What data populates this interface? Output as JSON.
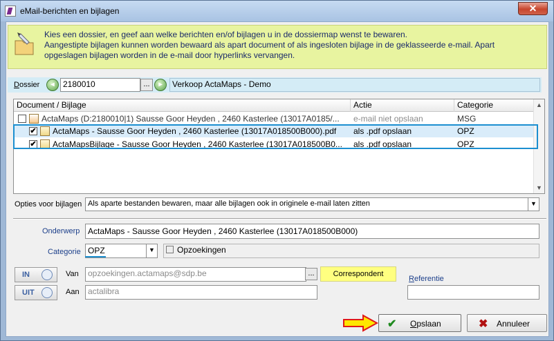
{
  "window": {
    "title": "eMail-berichten en bijlagen",
    "close": "✕"
  },
  "info": {
    "line1": "Kies een dossier, en geef aan welke berichten en/of bijlagen u in de dossiermap wenst te bewaren.",
    "line2": "Aangestipte bijlagen kunnen worden bewaard als apart document of als ingesloten bijlage in de geklasseerde e-mail. Apart",
    "line3": "opgeslagen bijlagen worden in de e-mail door hyperlinks vervangen."
  },
  "dossier": {
    "label": "Dossier",
    "number": "2180010",
    "dots": "...",
    "description": "Verkoop ActaMaps - Demo"
  },
  "list": {
    "columns": [
      "Document / Bijlage",
      "Actie",
      "Categorie"
    ],
    "rows": [
      {
        "checked": false,
        "name": "ActaMaps (D:2180010|1) Sausse Goor Heyden , 2460 Kasterlee (13017A0185/...",
        "action": "e-mail niet opslaan",
        "category": "MSG",
        "check_mark": ""
      },
      {
        "checked": true,
        "name": "ActaMaps - Sausse Goor Heyden , 2460 Kasterlee (13017A018500B000).pdf",
        "action": "als .pdf opslaan",
        "category": "OPZ",
        "check_mark": "✔"
      },
      {
        "checked": true,
        "name": "ActaMapsBijlage - Sausse Goor Heyden , 2460 Kasterlee (13017A018500B0...",
        "action": "als .pdf opslaan",
        "category": "OPZ",
        "check_mark": "✔"
      }
    ]
  },
  "options": {
    "label": "Opties voor bijlagen",
    "value": "Als aparte bestanden bewaren, maar alle bijlagen ook in originele e-mail laten zitten"
  },
  "subject": {
    "label": "Onderwerp",
    "value": "ActaMaps - Sausse Goor Heyden , 2460 Kasterlee (13017A018500B000)"
  },
  "category": {
    "label": "Categorie",
    "value": "OPZ",
    "description": "Opzoekingen"
  },
  "from": {
    "button": "IN",
    "label": "Van",
    "value": "opzoekingen.actamaps@sdp.be",
    "dots": "..."
  },
  "to": {
    "button": "UIT",
    "label": "Aan",
    "value": "actalibra"
  },
  "correspondent": "Correspondent",
  "reference": {
    "label": "Referentie",
    "value": ""
  },
  "buttons": {
    "save": "Opslaan",
    "cancel": "Annuleer"
  },
  "colors": {
    "highlight": "#1b8fd0",
    "info_bg": "#e8f4a0",
    "dossier_bg": "#d4ecf6",
    "correspondent_bg": "#ffff80"
  }
}
